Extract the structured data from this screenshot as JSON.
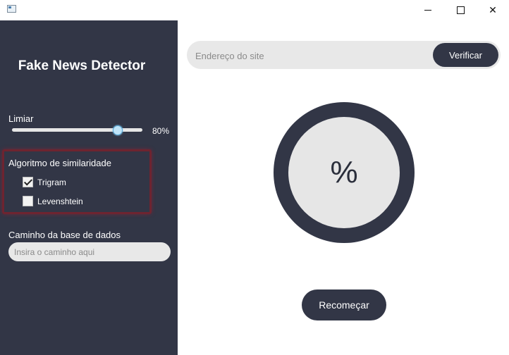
{
  "window": {
    "icons": {
      "app": "app-icon",
      "minimize": "minimize-icon",
      "maximize": "maximize-icon",
      "close": "close-icon"
    },
    "close_glyph": "✕"
  },
  "sidebar": {
    "title": "Fake News Detector",
    "threshold": {
      "label": "Limiar",
      "value": 80,
      "value_text": "80%"
    },
    "similarity": {
      "label": "Algoritmo de similaridade",
      "options": [
        {
          "label": "Trigram",
          "checked": true
        },
        {
          "label": "Levenshtein",
          "checked": false
        }
      ]
    },
    "database": {
      "label": "Caminho da base de dados",
      "value": "",
      "placeholder": "Insira o caminho aqui"
    }
  },
  "main": {
    "url": {
      "value": "",
      "placeholder": "Endereço do site"
    },
    "verify_label": "Verificar",
    "gauge_text": "%",
    "restart_label": "Recomeçar"
  },
  "colors": {
    "sidebar_bg": "#323646",
    "accent": "#323646",
    "input_bg": "#e8e8e8",
    "highlight_border": "#6e2430"
  }
}
